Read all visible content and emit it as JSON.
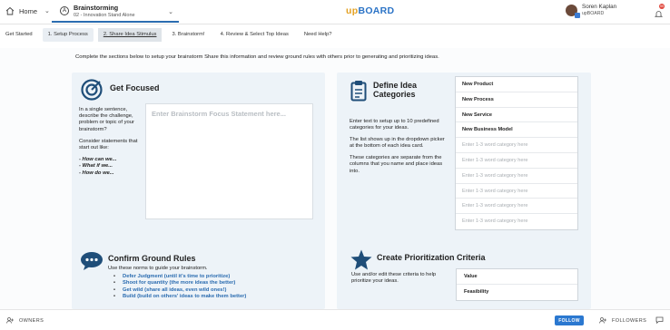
{
  "header": {
    "home_label": "Home",
    "board_title": "Brainstorming",
    "board_subtitle": "02 - Innovation Stand Alone",
    "logo_up": "up",
    "logo_board": "BOARD",
    "user_name": "Soren Kaplan",
    "user_org": "upBOARD",
    "notification_count": "99",
    "brand_color": "#2b73c6",
    "accent_color": "#e3a021"
  },
  "tabs": [
    {
      "label": "Get Started"
    },
    {
      "label": "1. Setup Process"
    },
    {
      "label": "2. Share Idea Stimulus"
    },
    {
      "label": "3. Brainstorm!"
    },
    {
      "label": "4. Review & Select Top Ideas"
    },
    {
      "label": "Need Help?"
    }
  ],
  "intro": "Complete the sections below to setup your brainstorm Share this information and review ground rules with others prior to generating and prioritizing ideas.",
  "focus": {
    "icon": "target-icon",
    "title": "Get Focused",
    "desc1": "In a single sentence, describe the challenge, problem or topic of your brainstorm?",
    "desc2": "Consider statements that start out like:",
    "example1": "- How can we...",
    "example2": "- What if we...",
    "example3": "- How do we...",
    "input_placeholder": "Enter Brainstorm Focus Statement here..."
  },
  "categories": {
    "icon": "clipboard-icon",
    "title": "Define Idea Categories",
    "desc1": "Enter text to setup up to 10 predefined categories for your ideas.",
    "desc2": "The list shows up in the dropdown picker at the bottom of each idea card.",
    "desc3": "These categories are separate from the columns that you name and place ideas into.",
    "items": [
      {
        "text": "New Product",
        "filled": true
      },
      {
        "text": "New Process",
        "filled": true
      },
      {
        "text": "New Service",
        "filled": true
      },
      {
        "text": "New Business Model",
        "filled": true
      },
      {
        "text": "Enter 1-3 word category here",
        "filled": false
      },
      {
        "text": "Enter 1-3 word category here",
        "filled": false
      },
      {
        "text": "Enter 1-3 word category here",
        "filled": false
      },
      {
        "text": "Enter 1-3 word category here",
        "filled": false
      },
      {
        "text": "Enter 1-3 word category here",
        "filled": false
      },
      {
        "text": "Enter 1-3 word category here",
        "filled": false
      }
    ]
  },
  "rules": {
    "icon": "speech-bubble-icon",
    "title": "Confirm Ground Rules",
    "subtitle": "Use these norms to guide your brainstorm.",
    "items": [
      "Defer Judgment (until it's time to prioritize)",
      "Shoot for quantity (the more ideas the better)",
      "Get wild (share all ideas, even wild ones!)",
      "Build (build on others' ideas to make them better)"
    ]
  },
  "criteria": {
    "icon": "star-icon",
    "title": "Create Prioritization Criteria",
    "desc": "Use and/or edit these criteria to help prioritize your ideas.",
    "items": [
      "Value",
      "Feasibility"
    ]
  },
  "footer": {
    "owners_label": "OWNERS",
    "follow_label": "FOLLOW",
    "followers_label": "FOLLOWERS"
  }
}
